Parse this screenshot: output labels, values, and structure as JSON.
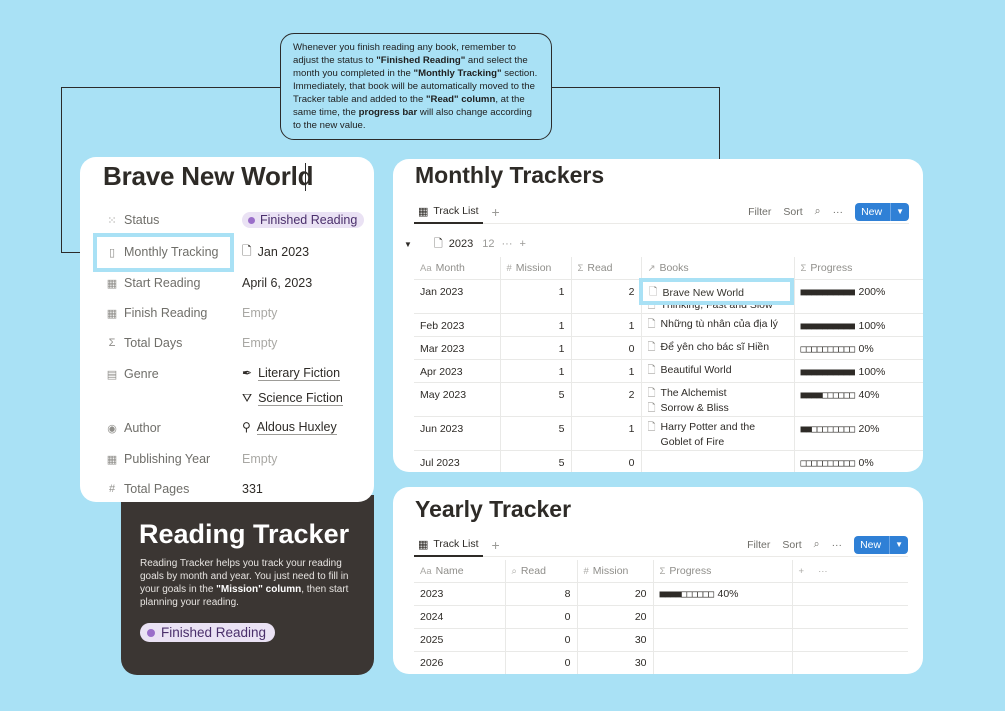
{
  "callout": {
    "t1": "Whenever you finish reading any book, remember to adjust the status to ",
    "b1": "\"Finished Reading\"",
    "t2": " and select the month you completed in the ",
    "b2": "\"Monthly Tracking\"",
    "t3": " section. Immediately, that book will be automatically moved to the Tracker table and added to the ",
    "b3": "\"Read\" column",
    "t4": ", at the same time, the ",
    "b4": "progress bar",
    "t5": " will also change according to the new value."
  },
  "book": {
    "title": "Brave New World",
    "props": [
      {
        "icon": "status-icon",
        "glyph": "⁙",
        "label": "Status"
      },
      {
        "icon": "bookmark-icon",
        "glyph": "▯",
        "label": "Monthly Tracking"
      },
      {
        "icon": "calendar-icon",
        "glyph": "▦",
        "label": "Start Reading"
      },
      {
        "icon": "calendar-icon",
        "glyph": "▦",
        "label": "Finish Reading"
      },
      {
        "icon": "sigma-icon",
        "glyph": "Σ",
        "label": "Total Days"
      },
      {
        "icon": "layers-icon",
        "glyph": "▤",
        "label": "Genre"
      },
      {
        "icon": "person-icon",
        "glyph": "◉",
        "label": "Author"
      },
      {
        "icon": "calendar-icon",
        "glyph": "▦",
        "label": "Publishing Year"
      },
      {
        "icon": "hash-icon",
        "glyph": "#",
        "label": "Total Pages"
      }
    ],
    "status": "Finished Reading",
    "monthly_tracking": "Jan 2023",
    "start_reading": "April 6, 2023",
    "finish_reading": "Empty",
    "total_days": "Empty",
    "genre": [
      "Literary Fiction",
      "Science Fiction"
    ],
    "author": "Aldous Huxley",
    "publishing_year": "Empty",
    "total_pages": "331"
  },
  "promo": {
    "title": "Reading Tracker",
    "text1": "Reading Tracker helps you track your reading goals by month and year. You just need to fill in your goals in the ",
    "bold": "\"Mission\" column",
    "text2": ", then start planning your reading.",
    "pill": "Finished Reading"
  },
  "monthly": {
    "title": "Monthly Trackers",
    "tab": "Track List",
    "filter": "Filter",
    "sort": "Sort",
    "new": "New",
    "group": {
      "name": "2023",
      "count": "12"
    },
    "columns": [
      "Month",
      "Mission",
      "Read",
      "Books",
      "Progress"
    ],
    "rows": [
      {
        "month": "Jan 2023",
        "mission": "1",
        "read": "2",
        "books": [
          "Brave New World",
          "Thinking, Fast and Slow"
        ],
        "progress_filled": 10,
        "progress_text": "200%"
      },
      {
        "month": "Feb 2023",
        "mission": "1",
        "read": "1",
        "books": [
          "Những tù nhân của địa lý"
        ],
        "progress_filled": 10,
        "progress_text": "100%"
      },
      {
        "month": "Mar 2023",
        "mission": "1",
        "read": "0",
        "books": [
          "Để yên cho bác sĩ Hiền"
        ],
        "progress_filled": 0,
        "progress_text": "0%"
      },
      {
        "month": "Apr 2023",
        "mission": "1",
        "read": "1",
        "books": [
          "Beautiful World"
        ],
        "progress_filled": 10,
        "progress_text": "100%"
      },
      {
        "month": "May 2023",
        "mission": "5",
        "read": "2",
        "books": [
          "The Alchemist",
          "Sorrow & Bliss"
        ],
        "progress_filled": 4,
        "progress_text": "40%"
      },
      {
        "month": "Jun 2023",
        "mission": "5",
        "read": "1",
        "books": [
          "Harry Potter and the Goblet of Fire"
        ],
        "progress_filled": 2,
        "progress_text": "20%"
      },
      {
        "month": "Jul 2023",
        "mission": "5",
        "read": "0",
        "books": [],
        "progress_filled": 0,
        "progress_text": "0%"
      }
    ]
  },
  "yearly": {
    "title": "Yearly Tracker",
    "tab": "Track List",
    "filter": "Filter",
    "sort": "Sort",
    "new": "New",
    "columns": [
      "Name",
      "Read",
      "Mission",
      "Progress"
    ],
    "rows": [
      {
        "name": "2023",
        "read": "8",
        "mission": "20",
        "progress_filled": 4,
        "progress_text": "40%"
      },
      {
        "name": "2024",
        "read": "0",
        "mission": "20",
        "progress_filled": null,
        "progress_text": ""
      },
      {
        "name": "2025",
        "read": "0",
        "mission": "30",
        "progress_filled": null,
        "progress_text": ""
      },
      {
        "name": "2026",
        "read": "0",
        "mission": "30",
        "progress_filled": null,
        "progress_text": ""
      }
    ]
  }
}
